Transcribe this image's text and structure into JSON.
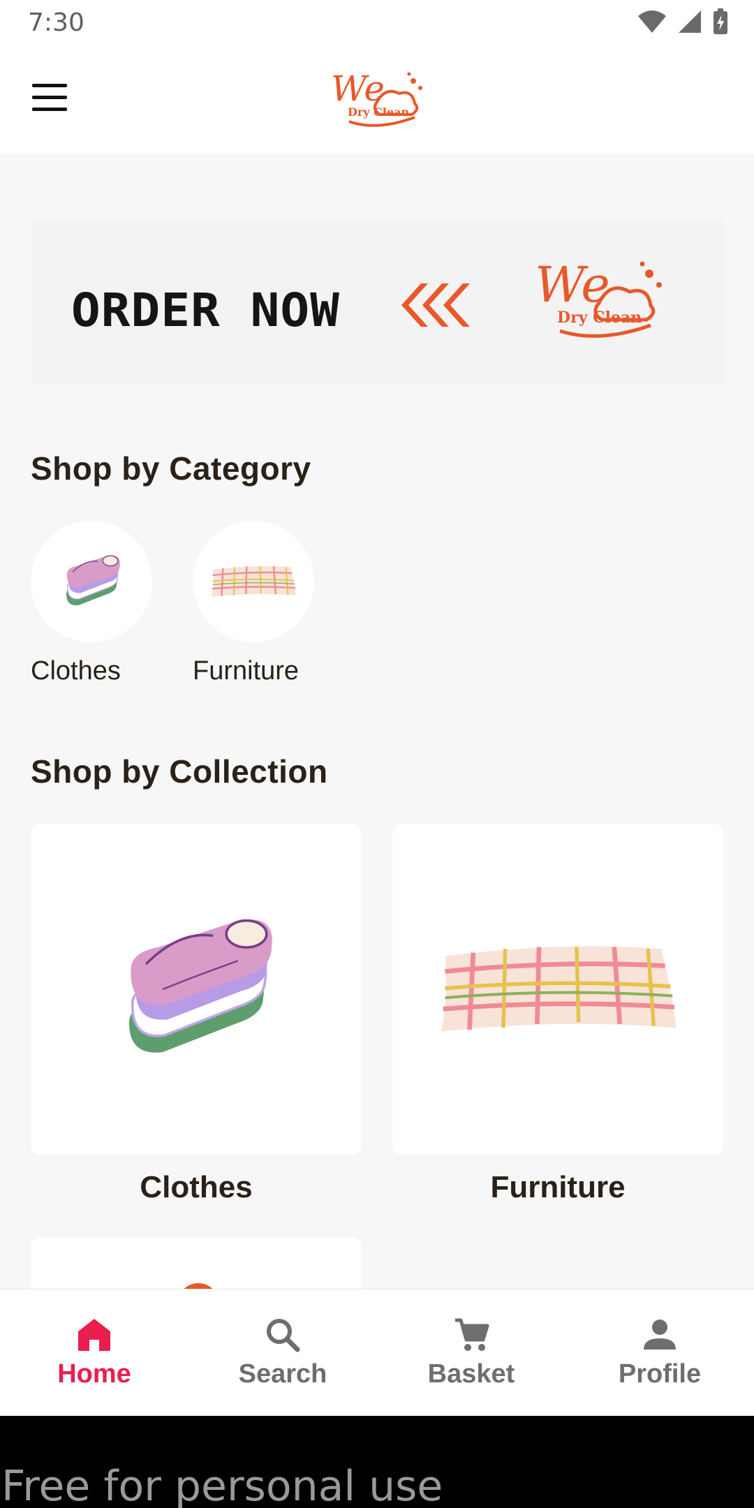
{
  "status_bar": {
    "time": "7:30",
    "icons": [
      "wifi-icon",
      "signal-icon",
      "battery-charging-icon"
    ]
  },
  "header": {
    "menu_icon": "hamburger-menu-icon",
    "logo": {
      "line1": "We",
      "line2": "Dry Clean",
      "color": "#e8582a"
    }
  },
  "banner": {
    "text": "ORDER NOW",
    "arrow_icon": "triple-chevron-left-icon",
    "logo": {
      "line1": "We",
      "line2": "Dry Clean"
    }
  },
  "categories": {
    "title": "Shop by Category",
    "items": [
      {
        "label": "Clothes",
        "icon": "folded-clothes-icon"
      },
      {
        "label": "Furniture",
        "icon": "plaid-blanket-icon"
      }
    ]
  },
  "collections": {
    "title": "Shop by Collection",
    "items": [
      {
        "label": "Clothes",
        "icon": "folded-clothes-icon"
      },
      {
        "label": "Furniture",
        "icon": "plaid-blanket-icon"
      }
    ]
  },
  "bottom_nav": {
    "items": [
      {
        "label": "Home",
        "icon": "home-icon",
        "active": true
      },
      {
        "label": "Search",
        "icon": "search-icon",
        "active": false
      },
      {
        "label": "Basket",
        "icon": "cart-icon",
        "active": false
      },
      {
        "label": "Profile",
        "icon": "person-icon",
        "active": false
      }
    ],
    "active_color": "#e91e4f",
    "inactive_color": "#6e6e6e"
  },
  "footer": {
    "text": "Free for personal use"
  }
}
